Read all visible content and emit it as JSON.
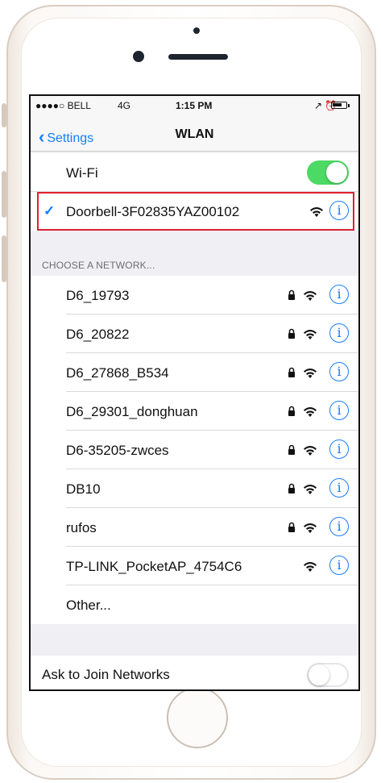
{
  "statusbar": {
    "carrier": "●●●●○ BELL",
    "network": "4G",
    "time": "1:15 PM",
    "indicators": "↗ ⏰"
  },
  "navbar": {
    "back_label": "Settings",
    "title": "WLAN"
  },
  "wifi": {
    "label": "Wi-Fi",
    "enabled": true
  },
  "connected": {
    "name": "Doorbell-3F02835YAZ00102",
    "info": "i"
  },
  "section_header": "CHOOSE A NETWORK...",
  "networks": [
    {
      "name": "D6_19793",
      "locked": true
    },
    {
      "name": "D6_20822",
      "locked": true
    },
    {
      "name": "D6_27868_B534",
      "locked": true
    },
    {
      "name": "D6_29301_donghuan",
      "locked": true
    },
    {
      "name": "D6-35205-zwces",
      "locked": true
    },
    {
      "name": "DB10",
      "locked": true
    },
    {
      "name": "rufos",
      "locked": true
    },
    {
      "name": "TP-LINK_PocketAP_4754C6",
      "locked": false
    }
  ],
  "other_label": "Other...",
  "ask_to_join": {
    "label": "Ask to Join Networks",
    "enabled": false
  },
  "info_glyph": "i",
  "colors": {
    "accent": "#157efb",
    "toggle_on": "#4cd964",
    "highlight": "#e0202e"
  }
}
